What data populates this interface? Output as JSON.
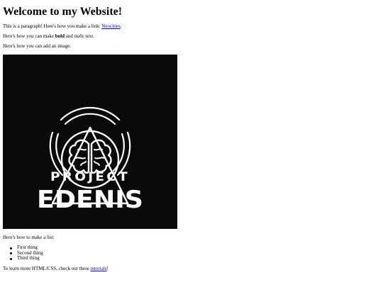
{
  "heading": "Welcome to my Website!",
  "paragraph_link": {
    "before": "This is a paragraph! Here's how you make a link: ",
    "link_text": "Neocities",
    "after": "."
  },
  "paragraph_format": {
    "before": "Here's how you can make ",
    "bold": "bold",
    "middle": " and ",
    "italic": "italic",
    "after": " text."
  },
  "paragraph_image": "Here's how you can add an image:",
  "image": {
    "alt": "Project Edenis logo",
    "line1": "PROJECT",
    "line2": "EDENIS",
    "background": "#0a0a0a",
    "foreground": "#ffffff"
  },
  "paragraph_list": "Here's how to make a list:",
  "list_items": [
    "First thing",
    "Second thing",
    "Third thing"
  ],
  "paragraph_learn": {
    "before": "To learn more HTML/CSS, check out these ",
    "link_text": "tutorials",
    "after": "!"
  },
  "colors": {
    "link": "#0000ee",
    "text": "#000000",
    "background": "#ffffff"
  }
}
